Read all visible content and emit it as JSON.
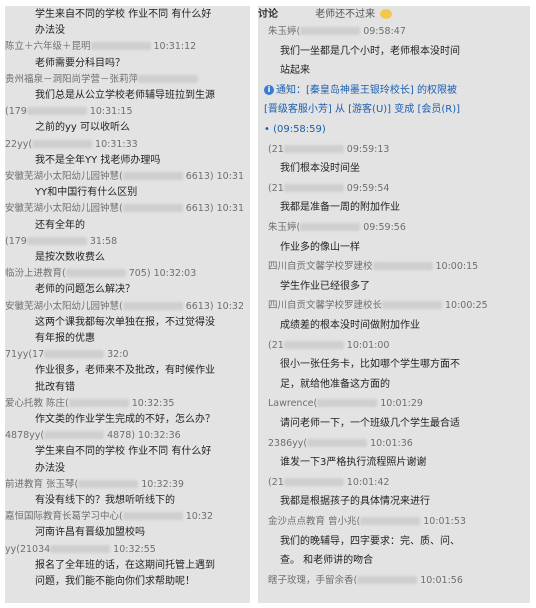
{
  "left": {
    "rows": [
      {
        "type": "msg",
        "text": "学生来自不同的学校 作业不同 有什么好"
      },
      {
        "type": "msg",
        "text": "办法没"
      },
      {
        "type": "meta",
        "text": "陈立＋六年级＋昆明",
        "time": "10:31:12"
      },
      {
        "type": "msg",
        "text": "老师需要分科目吗？"
      },
      {
        "type": "meta",
        "text": "贵州福泉－洞阳尚学营－张莉萍"
      },
      {
        "type": "msg",
        "text": "我们总是从公立学校老师辅导班拉到生源"
      },
      {
        "type": "meta",
        "text": "(179",
        "time": "10:31:15"
      },
      {
        "type": "msg",
        "text": "之前的yy 可以收听么"
      },
      {
        "type": "meta",
        "text": "22yy(",
        "time": "10:31:33"
      },
      {
        "type": "msg",
        "text": "我不是全年YY  找老师办理吗"
      },
      {
        "type": "meta",
        "text": "安徽芜湖小太阳幼儿园钟慧(",
        "time": "6613) 10:31"
      },
      {
        "type": "msg",
        "text": "YY和中国行有什么区别"
      },
      {
        "type": "meta",
        "text": "安徽芜湖小太阳幼儿园钟慧(",
        "time": "6613) 10:31"
      },
      {
        "type": "msg",
        "text": "还有全年的"
      },
      {
        "type": "meta",
        "text": "(179",
        "time": "31:58"
      },
      {
        "type": "msg",
        "text": "是按次数收费么"
      },
      {
        "type": "meta",
        "text": "临汾上进教育(",
        "time": "705) 10:32:03"
      },
      {
        "type": "msg",
        "text": "老师的问题怎么解决？"
      },
      {
        "type": "meta",
        "text": "安徽芜湖小太阳幼儿园钟慧(",
        "time": "6613) 10:32"
      },
      {
        "type": "msg",
        "text": "这两个课我都每次单独在报，不过觉得没"
      },
      {
        "type": "msg",
        "text": "有年报的优惠"
      },
      {
        "type": "meta",
        "text": "71yy(17",
        "time": "32:0"
      },
      {
        "type": "msg",
        "text": "作业很多，老师来不及批改，有时候作业"
      },
      {
        "type": "msg",
        "text": "批改有错"
      },
      {
        "type": "meta",
        "text": "爱心托教  陈庄(",
        "time": "10:32:35"
      },
      {
        "type": "msg",
        "text": "作文类的作业学生完成的不好，怎么办？"
      },
      {
        "type": "meta",
        "text": "4878yy(",
        "time": "4878) 10:32:36"
      },
      {
        "type": "msg",
        "text": "学生来自不同的学校 作业不同 有什么好"
      },
      {
        "type": "msg",
        "text": "办法没"
      },
      {
        "type": "meta",
        "text": "前进教育 张玉琴(",
        "time": "10:32:39"
      },
      {
        "type": "msg",
        "text": "有没有线下的？我想听听线下的"
      },
      {
        "type": "meta",
        "text": "嘉恒国际教育长葛学习中心(",
        "time": "10:32"
      },
      {
        "type": "msg",
        "text": "河南许昌有晋级加盟校吗"
      },
      {
        "type": "meta",
        "text": "yy(21034",
        "time": "10:32:55"
      },
      {
        "type": "msg",
        "text": "报名了全年班的话，在这期间托管上遇到"
      },
      {
        "type": "msg",
        "text": "问题，我们能不能向你们求帮助呢！"
      }
    ]
  },
  "right": {
    "header_title": "讨论",
    "header_msg": "老师还不过来",
    "rows": [
      {
        "type": "meta",
        "text": "朱玉婷(",
        "time": "09:58:47"
      },
      {
        "type": "msg",
        "text": "我们一坐都是几个小时，老师根本没时间"
      },
      {
        "type": "msg",
        "text": "站起来"
      },
      {
        "type": "notice",
        "text": "通知：[秦皇岛神墨王银玲校长] 的权限被"
      },
      {
        "type": "notice",
        "text": "[晋级客服小芳] 从 [游客(U)] 变成 [会员(R)]"
      },
      {
        "type": "notice",
        "text": "(09:58:59)"
      },
      {
        "type": "meta",
        "text": "(21",
        "time": "09:59:13"
      },
      {
        "type": "msg",
        "text": "我们根本没时间坐"
      },
      {
        "type": "meta",
        "text": "(21",
        "time": "09:59:54"
      },
      {
        "type": "msg",
        "text": "我都是准备一周的附加作业"
      },
      {
        "type": "meta",
        "text": "朱玉婷(",
        "time": "09:59:56"
      },
      {
        "type": "msg",
        "text": "作业多的像山一样"
      },
      {
        "type": "meta",
        "text": "四川自贡文馨学校罗建校",
        "time": "10:00:15"
      },
      {
        "type": "msg",
        "text": "学生作业已经很多了"
      },
      {
        "type": "meta",
        "text": "四川自贡文馨学校罗建校长",
        "time": "10:00:25"
      },
      {
        "type": "msg",
        "text": "成绩差的根本没时间做附加作业"
      },
      {
        "type": "meta",
        "text": "(21",
        "time": "10:01:00"
      },
      {
        "type": "msg",
        "text": "很小一张任务卡，比如哪个学生哪方面不"
      },
      {
        "type": "msg",
        "text": "足，就给他准备这方面的"
      },
      {
        "type": "meta",
        "text": "Lawrence(",
        "time": "10:01:29"
      },
      {
        "type": "msg",
        "text": "请问老师一下，一个班级几个学生最合适"
      },
      {
        "type": "meta",
        "text": "2386yy(",
        "time": "10:01:36"
      },
      {
        "type": "msg",
        "text": "谁发一下3严格执行流程照片谢谢"
      },
      {
        "type": "meta",
        "text": "(21",
        "time": "10:01:42"
      },
      {
        "type": "msg",
        "text": "我都是根据孩子的具体情况来进行"
      },
      {
        "type": "meta",
        "text": "金沙点点教育  曾小兆(",
        "time": "10:01:53"
      },
      {
        "type": "msg",
        "text": "我们的晚辅导，四字要求：完、质、问、"
      },
      {
        "type": "msg",
        "text": "查。 和老师讲的吻合"
      },
      {
        "type": "meta",
        "text": "瞎子玫瑰，手留余香(",
        "time": "10:01:56"
      }
    ]
  }
}
